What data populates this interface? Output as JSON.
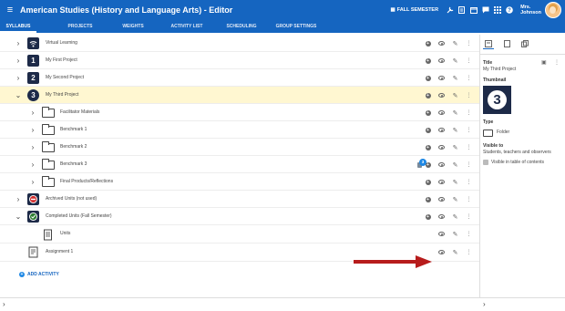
{
  "header": {
    "menu_icon": "hamburger-icon",
    "title": "American Studies (History and Language Arts) - Editor",
    "semester_label": "FALL SEMESTER",
    "user_name_line1": "Mrs.",
    "user_name_line2": "Johnson"
  },
  "tabs": [
    {
      "label": "SYLLABUS",
      "active": true
    },
    {
      "label": "PROJECTS",
      "active": false
    },
    {
      "label": "WEIGHTS",
      "active": false
    },
    {
      "label": "ACTIVITY LIST",
      "active": false
    },
    {
      "label": "SCHEDULING",
      "active": false
    },
    {
      "label": "GROUP SETTINGS",
      "active": false
    }
  ],
  "rows": [
    {
      "label": "Virtual Learning",
      "icon": "wifi-icon",
      "indent": 0,
      "chevron": "right"
    },
    {
      "label": "My First Project",
      "icon": "number-1-icon",
      "number": "1",
      "indent": 0,
      "chevron": "right"
    },
    {
      "label": "My Second Project",
      "icon": "number-2-icon",
      "number": "2",
      "indent": 0,
      "chevron": "right"
    },
    {
      "label": "My Third Project",
      "icon": "number-3-icon",
      "number": "3",
      "indent": 0,
      "chevron": "down",
      "selected": true
    },
    {
      "label": "Facilitator Materials",
      "icon": "folder-icon",
      "indent": 1,
      "chevron": "right"
    },
    {
      "label": "Benchmark 1",
      "icon": "folder-icon",
      "indent": 1,
      "chevron": "right"
    },
    {
      "label": "Benchmark 2",
      "icon": "folder-icon",
      "indent": 1,
      "chevron": "right"
    },
    {
      "label": "Benchmark 3",
      "icon": "folder-icon",
      "indent": 1,
      "chevron": "right",
      "badge": "3"
    },
    {
      "label": "Final Products/Reflections",
      "icon": "folder-icon",
      "indent": 1,
      "chevron": "right"
    },
    {
      "label": "Archived Units (not used)",
      "icon": "no-entry-icon",
      "indent": 0,
      "chevron": "right"
    },
    {
      "label": "Completed Units (Fall Semester)",
      "icon": "check-circle-icon",
      "indent": 0,
      "chevron": "down"
    },
    {
      "label": "Units",
      "icon": "document-icon",
      "indent": 1,
      "chevron": "none"
    },
    {
      "label": "Assignment 1",
      "icon": "assignment-icon",
      "indent": 1,
      "chevron": "none"
    }
  ],
  "add_activity_label": "ADD ACTIVITY",
  "side_panel": {
    "title_heading": "Title",
    "title_value": "My Third Project",
    "thumbnail_heading": "Thumbnail",
    "thumbnail_number": "3",
    "type_heading": "Type",
    "type_value": "Folder",
    "visible_heading": "Visible to",
    "visible_value": "Students, teachers and observers",
    "table_contents_label": "Visible in table of contents"
  },
  "colors": {
    "primary": "#1565c0",
    "selected_row": "#fff7d1",
    "navy_icon": "#1d2a48",
    "arrow": "#b71c1c"
  }
}
